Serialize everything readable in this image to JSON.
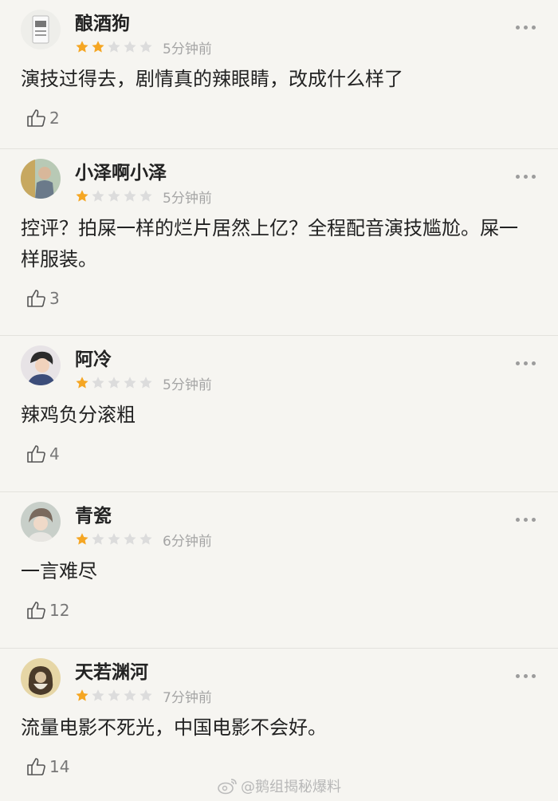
{
  "reviews": [
    {
      "name": "酿酒狗",
      "stars": 2,
      "time": "5分钟前",
      "text": "演技过得去，剧情真的辣眼睛，改成什么样了",
      "likes": "2"
    },
    {
      "name": "小泽啊小泽",
      "stars": 1,
      "time": "5分钟前",
      "text": "控评？拍屎一样的烂片居然上亿？全程配音演技尴尬。屎一样服装。",
      "likes": "3"
    },
    {
      "name": "阿冷",
      "stars": 1,
      "time": "5分钟前",
      "text": "辣鸡负分滚粗",
      "likes": "4"
    },
    {
      "name": "青瓷",
      "stars": 1,
      "time": "6分钟前",
      "text": "一言难尽",
      "likes": "12"
    },
    {
      "name": "天若渊河",
      "stars": 1,
      "time": "7分钟前",
      "text": "流量电影不死光，中国电影不会好。",
      "likes": "14"
    }
  ],
  "max_stars": 5,
  "colors": {
    "star_on": "#f5a623",
    "star_off": "#dcdcdc"
  },
  "icons": {
    "like": "thumbs-up-icon",
    "more": "more-dots-icon",
    "watermark": "weibo-icon"
  },
  "watermark": "@鹅组揭秘爆料"
}
